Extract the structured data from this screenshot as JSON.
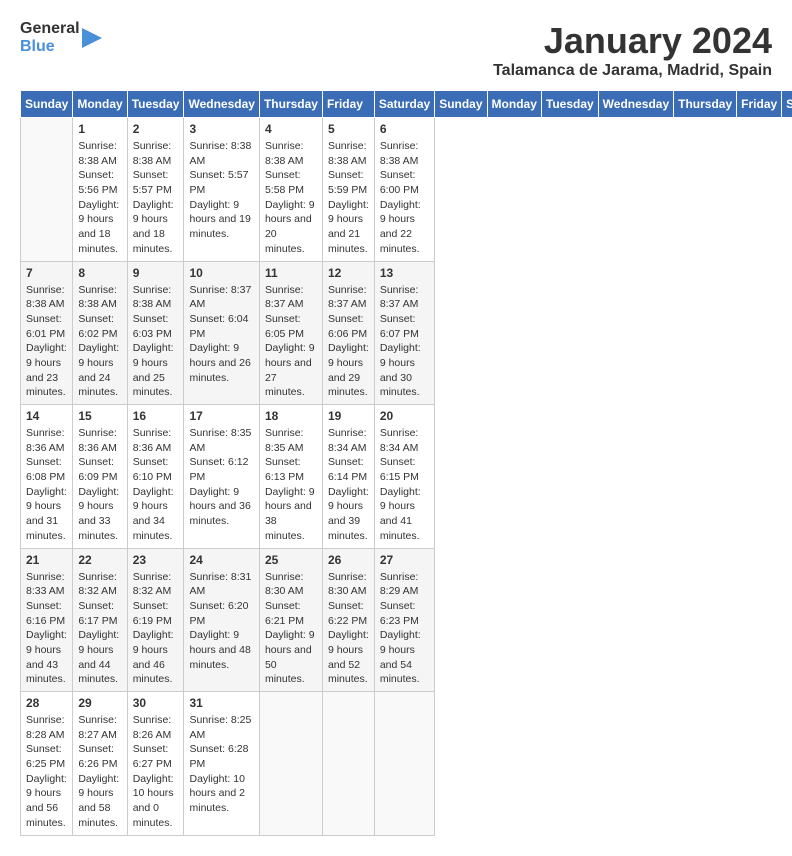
{
  "header": {
    "logo_line1": "General",
    "logo_line2": "Blue",
    "month_title": "January 2024",
    "subtitle": "Talamanca de Jarama, Madrid, Spain"
  },
  "weekdays": [
    "Sunday",
    "Monday",
    "Tuesday",
    "Wednesday",
    "Thursday",
    "Friday",
    "Saturday"
  ],
  "weeks": [
    [
      {
        "day": "",
        "sunrise": "",
        "sunset": "",
        "daylight": ""
      },
      {
        "day": "1",
        "sunrise": "Sunrise: 8:38 AM",
        "sunset": "Sunset: 5:56 PM",
        "daylight": "Daylight: 9 hours and 18 minutes."
      },
      {
        "day": "2",
        "sunrise": "Sunrise: 8:38 AM",
        "sunset": "Sunset: 5:57 PM",
        "daylight": "Daylight: 9 hours and 18 minutes."
      },
      {
        "day": "3",
        "sunrise": "Sunrise: 8:38 AM",
        "sunset": "Sunset: 5:57 PM",
        "daylight": "Daylight: 9 hours and 19 minutes."
      },
      {
        "day": "4",
        "sunrise": "Sunrise: 8:38 AM",
        "sunset": "Sunset: 5:58 PM",
        "daylight": "Daylight: 9 hours and 20 minutes."
      },
      {
        "day": "5",
        "sunrise": "Sunrise: 8:38 AM",
        "sunset": "Sunset: 5:59 PM",
        "daylight": "Daylight: 9 hours and 21 minutes."
      },
      {
        "day": "6",
        "sunrise": "Sunrise: 8:38 AM",
        "sunset": "Sunset: 6:00 PM",
        "daylight": "Daylight: 9 hours and 22 minutes."
      }
    ],
    [
      {
        "day": "7",
        "sunrise": "Sunrise: 8:38 AM",
        "sunset": "Sunset: 6:01 PM",
        "daylight": "Daylight: 9 hours and 23 minutes."
      },
      {
        "day": "8",
        "sunrise": "Sunrise: 8:38 AM",
        "sunset": "Sunset: 6:02 PM",
        "daylight": "Daylight: 9 hours and 24 minutes."
      },
      {
        "day": "9",
        "sunrise": "Sunrise: 8:38 AM",
        "sunset": "Sunset: 6:03 PM",
        "daylight": "Daylight: 9 hours and 25 minutes."
      },
      {
        "day": "10",
        "sunrise": "Sunrise: 8:37 AM",
        "sunset": "Sunset: 6:04 PM",
        "daylight": "Daylight: 9 hours and 26 minutes."
      },
      {
        "day": "11",
        "sunrise": "Sunrise: 8:37 AM",
        "sunset": "Sunset: 6:05 PM",
        "daylight": "Daylight: 9 hours and 27 minutes."
      },
      {
        "day": "12",
        "sunrise": "Sunrise: 8:37 AM",
        "sunset": "Sunset: 6:06 PM",
        "daylight": "Daylight: 9 hours and 29 minutes."
      },
      {
        "day": "13",
        "sunrise": "Sunrise: 8:37 AM",
        "sunset": "Sunset: 6:07 PM",
        "daylight": "Daylight: 9 hours and 30 minutes."
      }
    ],
    [
      {
        "day": "14",
        "sunrise": "Sunrise: 8:36 AM",
        "sunset": "Sunset: 6:08 PM",
        "daylight": "Daylight: 9 hours and 31 minutes."
      },
      {
        "day": "15",
        "sunrise": "Sunrise: 8:36 AM",
        "sunset": "Sunset: 6:09 PM",
        "daylight": "Daylight: 9 hours and 33 minutes."
      },
      {
        "day": "16",
        "sunrise": "Sunrise: 8:36 AM",
        "sunset": "Sunset: 6:10 PM",
        "daylight": "Daylight: 9 hours and 34 minutes."
      },
      {
        "day": "17",
        "sunrise": "Sunrise: 8:35 AM",
        "sunset": "Sunset: 6:12 PM",
        "daylight": "Daylight: 9 hours and 36 minutes."
      },
      {
        "day": "18",
        "sunrise": "Sunrise: 8:35 AM",
        "sunset": "Sunset: 6:13 PM",
        "daylight": "Daylight: 9 hours and 38 minutes."
      },
      {
        "day": "19",
        "sunrise": "Sunrise: 8:34 AM",
        "sunset": "Sunset: 6:14 PM",
        "daylight": "Daylight: 9 hours and 39 minutes."
      },
      {
        "day": "20",
        "sunrise": "Sunrise: 8:34 AM",
        "sunset": "Sunset: 6:15 PM",
        "daylight": "Daylight: 9 hours and 41 minutes."
      }
    ],
    [
      {
        "day": "21",
        "sunrise": "Sunrise: 8:33 AM",
        "sunset": "Sunset: 6:16 PM",
        "daylight": "Daylight: 9 hours and 43 minutes."
      },
      {
        "day": "22",
        "sunrise": "Sunrise: 8:32 AM",
        "sunset": "Sunset: 6:17 PM",
        "daylight": "Daylight: 9 hours and 44 minutes."
      },
      {
        "day": "23",
        "sunrise": "Sunrise: 8:32 AM",
        "sunset": "Sunset: 6:19 PM",
        "daylight": "Daylight: 9 hours and 46 minutes."
      },
      {
        "day": "24",
        "sunrise": "Sunrise: 8:31 AM",
        "sunset": "Sunset: 6:20 PM",
        "daylight": "Daylight: 9 hours and 48 minutes."
      },
      {
        "day": "25",
        "sunrise": "Sunrise: 8:30 AM",
        "sunset": "Sunset: 6:21 PM",
        "daylight": "Daylight: 9 hours and 50 minutes."
      },
      {
        "day": "26",
        "sunrise": "Sunrise: 8:30 AM",
        "sunset": "Sunset: 6:22 PM",
        "daylight": "Daylight: 9 hours and 52 minutes."
      },
      {
        "day": "27",
        "sunrise": "Sunrise: 8:29 AM",
        "sunset": "Sunset: 6:23 PM",
        "daylight": "Daylight: 9 hours and 54 minutes."
      }
    ],
    [
      {
        "day": "28",
        "sunrise": "Sunrise: 8:28 AM",
        "sunset": "Sunset: 6:25 PM",
        "daylight": "Daylight: 9 hours and 56 minutes."
      },
      {
        "day": "29",
        "sunrise": "Sunrise: 8:27 AM",
        "sunset": "Sunset: 6:26 PM",
        "daylight": "Daylight: 9 hours and 58 minutes."
      },
      {
        "day": "30",
        "sunrise": "Sunrise: 8:26 AM",
        "sunset": "Sunset: 6:27 PM",
        "daylight": "Daylight: 10 hours and 0 minutes."
      },
      {
        "day": "31",
        "sunrise": "Sunrise: 8:25 AM",
        "sunset": "Sunset: 6:28 PM",
        "daylight": "Daylight: 10 hours and 2 minutes."
      },
      {
        "day": "",
        "sunrise": "",
        "sunset": "",
        "daylight": ""
      },
      {
        "day": "",
        "sunrise": "",
        "sunset": "",
        "daylight": ""
      },
      {
        "day": "",
        "sunrise": "",
        "sunset": "",
        "daylight": ""
      }
    ]
  ]
}
